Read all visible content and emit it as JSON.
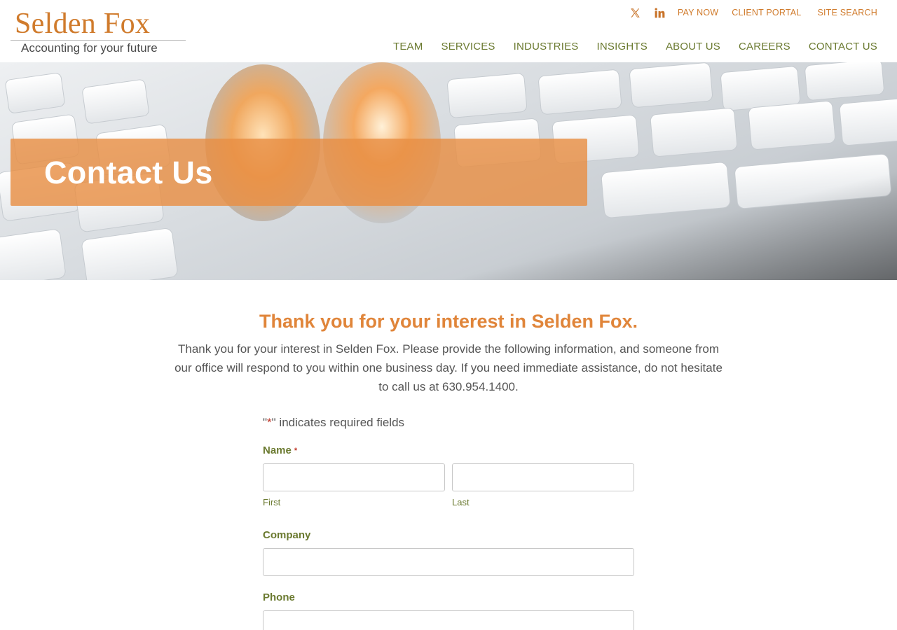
{
  "header": {
    "logo_name": "Selden Fox",
    "logo_tagline": "Accounting for your future",
    "social": [
      {
        "icon": "x-twitter-icon"
      },
      {
        "icon": "linkedin-icon"
      }
    ],
    "utility_links": [
      "PAY NOW",
      "CLIENT PORTAL",
      "SITE SEARCH"
    ],
    "nav": [
      "TEAM",
      "SERVICES",
      "INDUSTRIES",
      "INSIGHTS",
      "ABOUT US",
      "CAREERS",
      "CONTACT US"
    ]
  },
  "hero": {
    "title": "Contact Us"
  },
  "content": {
    "headline": "Thank you for your interest in Selden Fox.",
    "intro": "Thank you for your interest in Selden Fox. Please provide the following information, and someone from our office will respond to you within one business day. If you need immediate assistance, do not hesitate to call us at 630.954.1400."
  },
  "form": {
    "required_note_prefix": "\"",
    "required_star": "*",
    "required_note_suffix": "\" indicates required fields",
    "name_label": "Name",
    "name_required": "*",
    "first_label": "First",
    "last_label": "Last",
    "company_label": "Company",
    "phone_label": "Phone",
    "first_value": "",
    "last_value": "",
    "company_value": "",
    "phone_value": ""
  },
  "colors": {
    "brand_orange": "#d07b2c",
    "nav_olive": "#6b7a30",
    "banner_orange": "#e88f44",
    "required_red": "#c0392b"
  }
}
